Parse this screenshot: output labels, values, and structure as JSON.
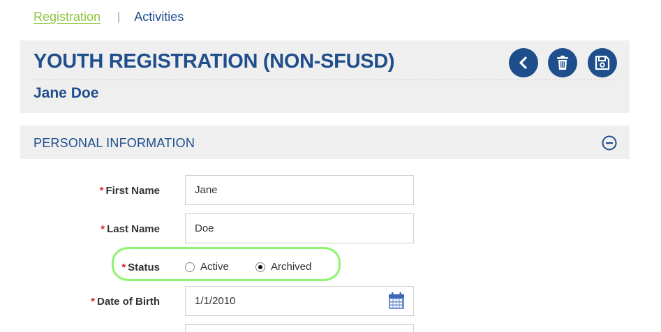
{
  "nav": {
    "tabs": [
      {
        "label": "Registration",
        "active": true
      },
      {
        "label": "Activities",
        "active": false
      }
    ],
    "separator": "|"
  },
  "header": {
    "title": "YOUTH REGISTRATION (NON-SFUSD)",
    "subtitle": "Jane Doe",
    "actions": [
      {
        "name": "back",
        "icon": "chevron-left-icon"
      },
      {
        "name": "delete",
        "icon": "trash-icon"
      },
      {
        "name": "save",
        "icon": "floppy-disk-icon"
      }
    ]
  },
  "section": {
    "title": "PERSONAL INFORMATION",
    "collapse_icon": "minus-circle-icon"
  },
  "form": {
    "required_marker": "*",
    "first_name": {
      "label": "First Name",
      "value": "Jane"
    },
    "last_name": {
      "label": "Last Name",
      "value": "Doe"
    },
    "status": {
      "label": "Status",
      "options": [
        "Active",
        "Archived"
      ],
      "selected": "Archived"
    },
    "dob": {
      "label": "Date of Birth",
      "value": "1/1/2010",
      "icon": "calendar-icon"
    }
  },
  "colors": {
    "primary": "#1f4e8c",
    "active_tab": "#8dc63f",
    "required": "#d9252a",
    "highlight": "#8ef56e",
    "panel_bg": "#efefef"
  }
}
